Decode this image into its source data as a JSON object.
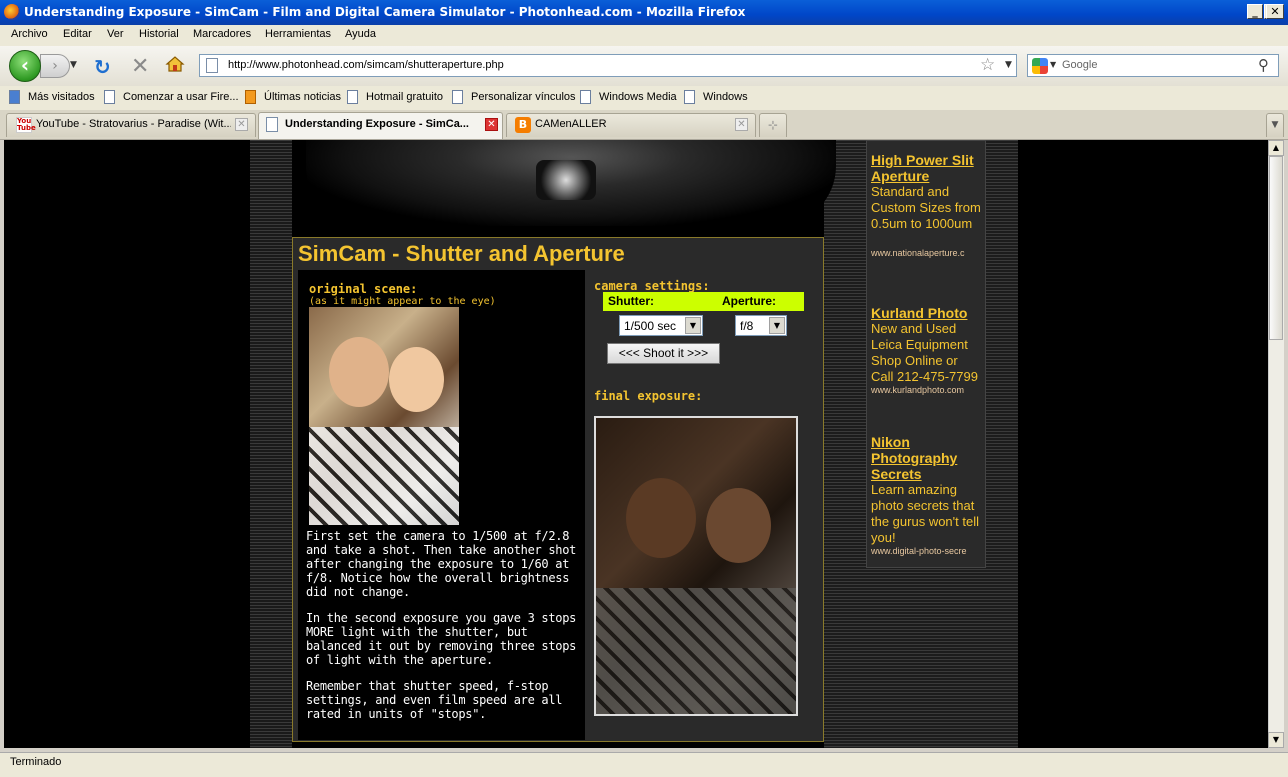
{
  "window": {
    "title": "Understanding Exposure - SimCam - Film and Digital Camera Simulator - Photonhead.com - Mozilla Firefox"
  },
  "menu": [
    "Archivo",
    "Editar",
    "Ver",
    "Historial",
    "Marcadores",
    "Herramientas",
    "Ayuda"
  ],
  "nav": {
    "url": "http://www.photonhead.com/simcam/shutteraperture.php",
    "search_placeholder": "Google"
  },
  "bookmarks": [
    "Más visitados",
    "Comenzar a usar Fire...",
    "Últimas noticias",
    "Hotmail gratuito",
    "Personalizar vínculos",
    "Windows Media",
    "Windows"
  ],
  "tabs": [
    {
      "label": "YouTube - Stratovarius - Paradise (Wit..."
    },
    {
      "label": "Understanding Exposure - SimCa..."
    },
    {
      "label": "CAMenALLER"
    }
  ],
  "page": {
    "title": "SimCam - Shutter and Aperture",
    "original_label": "original scene:",
    "original_sub": "(as it might appear to the eye)",
    "paragraphs": [
      "First set the camera to 1/500 at f/2.8 and take a shot. Then take another shot after changing the exposure to 1/60 at f/8. Notice how the overall brightness did not change.",
      "In the second exposure you gave 3 stops MORE light with the shutter, but balanced it out by removing three stops of light with the aperture.",
      "Remember that shutter speed, f-stop settings, and even film speed are all rated in units of \"stops\"."
    ],
    "camera_settings_label": "camera settings:",
    "shutter_label": "Shutter:",
    "aperture_label": "Aperture:",
    "shutter_value": "1/500 sec",
    "aperture_value": "f/8",
    "shoot_button": "<<< Shoot it >>>",
    "final_label": "final exposure:"
  },
  "ads": [
    {
      "title": "High Power Slit Aperture",
      "text": "Standard and Custom Sizes from 0.5um to 1000um",
      "url": "www.nationalaperture.c"
    },
    {
      "title": "Kurland Photo",
      "text": "New and Used Leica Equipment Shop Online or Call 212-475-7799",
      "url": "www.kurlandphoto.com"
    },
    {
      "title": "Nikon Photography Secrets",
      "text": "Learn amazing photo secrets that the gurus won't tell you!",
      "url": "www.digital-photo-secre"
    }
  ],
  "status": "Terminado",
  "colors": {
    "accent": "#f4c430",
    "settings_bar": "#ccff00"
  }
}
